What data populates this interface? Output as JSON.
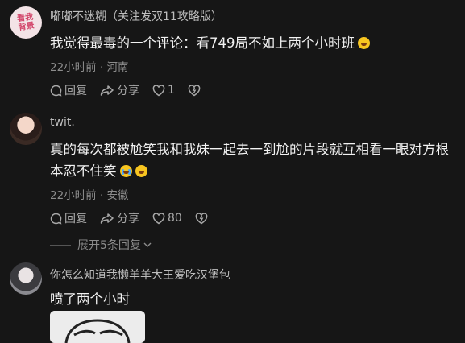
{
  "comments": [
    {
      "avatar_text": "看我\n背景",
      "username": "嘟嘟不迷糊（关注发双11攻略版）",
      "text": "我觉得最毒的一个评论：看749局不如上两个小时班",
      "time_location": "22小时前 · 河南",
      "reply_label": "回复",
      "share_label": "分享",
      "like_count": "1"
    },
    {
      "username": "twit.",
      "text": "真的每次都被尬笑我和我妹一起去一到尬的片段就互相看一眼对方根本忍不住笑",
      "time_location": "22小时前 · 安徽",
      "reply_label": "回复",
      "share_label": "分享",
      "like_count": "80",
      "expand_label": "展开5条回复"
    },
    {
      "username": "你怎么知道我懒羊羊大王爱吃汉堡包",
      "text": "喷了两个小时"
    }
  ],
  "icons": [
    "reply-icon",
    "share-icon",
    "heart-icon",
    "dislike-icon",
    "chevron-down-icon"
  ],
  "colors": {
    "background": "#161616",
    "text": "#f2f2f2",
    "muted": "#8c8c8c"
  }
}
